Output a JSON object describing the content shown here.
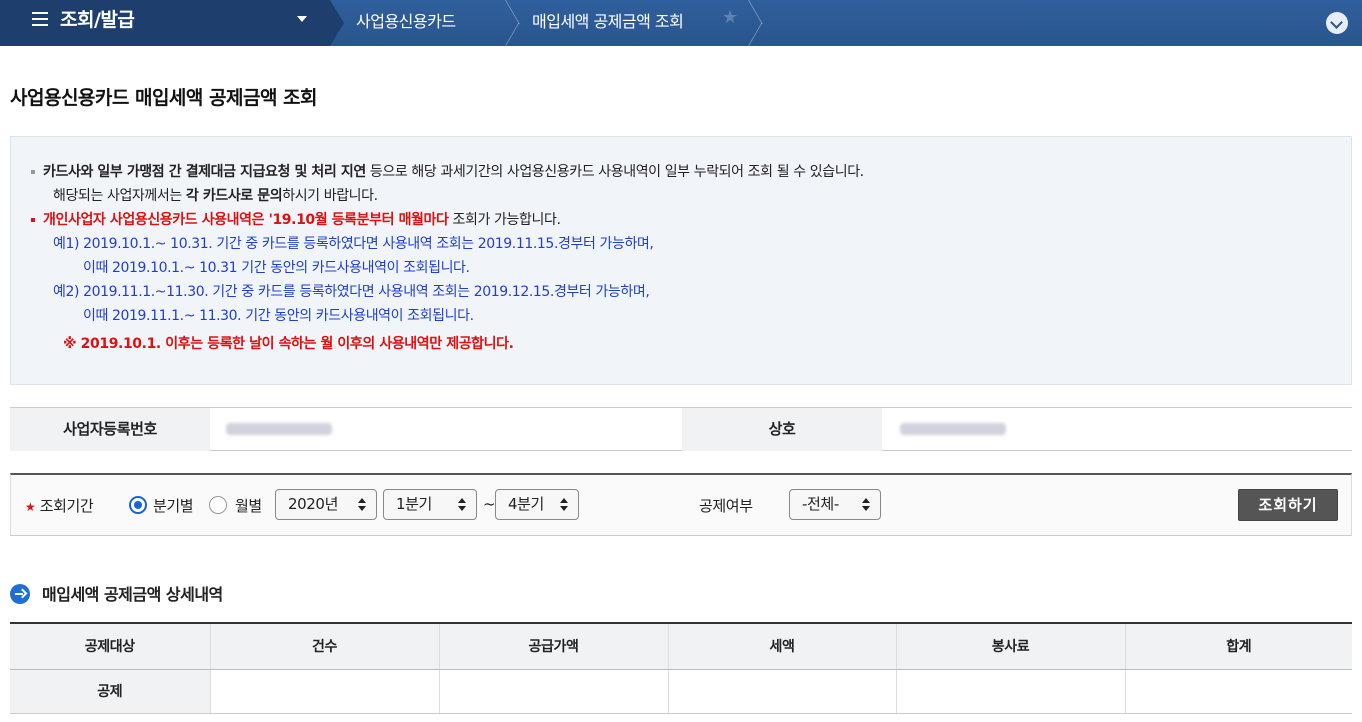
{
  "topbar": {
    "menu_title": "조회/발급",
    "breadcrumbs": [
      "사업용신용카드",
      "매입세액 공제금액 조회"
    ],
    "colors": {
      "bar": "#2a558e",
      "menu_segment": "#1e3f6e"
    }
  },
  "page_title": "사업용신용카드 매입세액 공제금액 조회",
  "notice": {
    "line1_bold": "카드사와 일부 가맹점 간 결제대금 지급요청 및 처리 지연",
    "line1_rest": " 등으로 해당 과세기간의 사업용신용카드 사용내역이 일부 누락되어 조회 될 수 있습니다.",
    "line2_pre": "해당되는 사업자께서는 ",
    "line2_bold": "각 카드사로 문의",
    "line2_post": "하시기 바랍니다.",
    "line3_red": "개인사업자 사업용신용카드 사용내역은 '19.10월 등록분부터 매월마다",
    "line3_rest": " 조회가 가능합니다.",
    "ex1a": "예1) 2019.10.1.~ 10.31. 기간 중 카드를 등록하였다면 사용내역 조회는 2019.11.15.경부터 가능하며,",
    "ex1b": "이때 2019.10.1.~ 10.31 기간 동안의 카드사용내역이 조회됩니다.",
    "ex2a": "예2) 2019.11.1.~11.30. 기간 중 카드를 등록하였다면 사용내역 조회는 2019.12.15.경부터 가능하며,",
    "ex2b": "이때 2019.11.1.~ 11.30. 기간 동안의 카드사용내역이 조회됩니다.",
    "warning": "※ 2019.10.1. 이후는 등록한 날이 속하는 월 이후의 사용내역만 제공합니다."
  },
  "info": {
    "biz_no_label": "사업자등록번호",
    "name_label": "상호"
  },
  "search": {
    "period_label": "조회기간",
    "radio_quarter": "분기별",
    "radio_month": "월별",
    "year": "2020년",
    "from_quarter": "1분기",
    "tilde": "~",
    "to_quarter": "4분기",
    "deduct_label": "공제여부",
    "deduct_value": "-전체-",
    "button": "조회하기"
  },
  "section_title": "매입세액 공제금액 상세내역",
  "table": {
    "headers": [
      "공제대상",
      "건수",
      "공급가액",
      "세액",
      "봉사료",
      "합계"
    ],
    "rows": [
      [
        "공제",
        "",
        "",
        "",
        "",
        ""
      ]
    ]
  }
}
